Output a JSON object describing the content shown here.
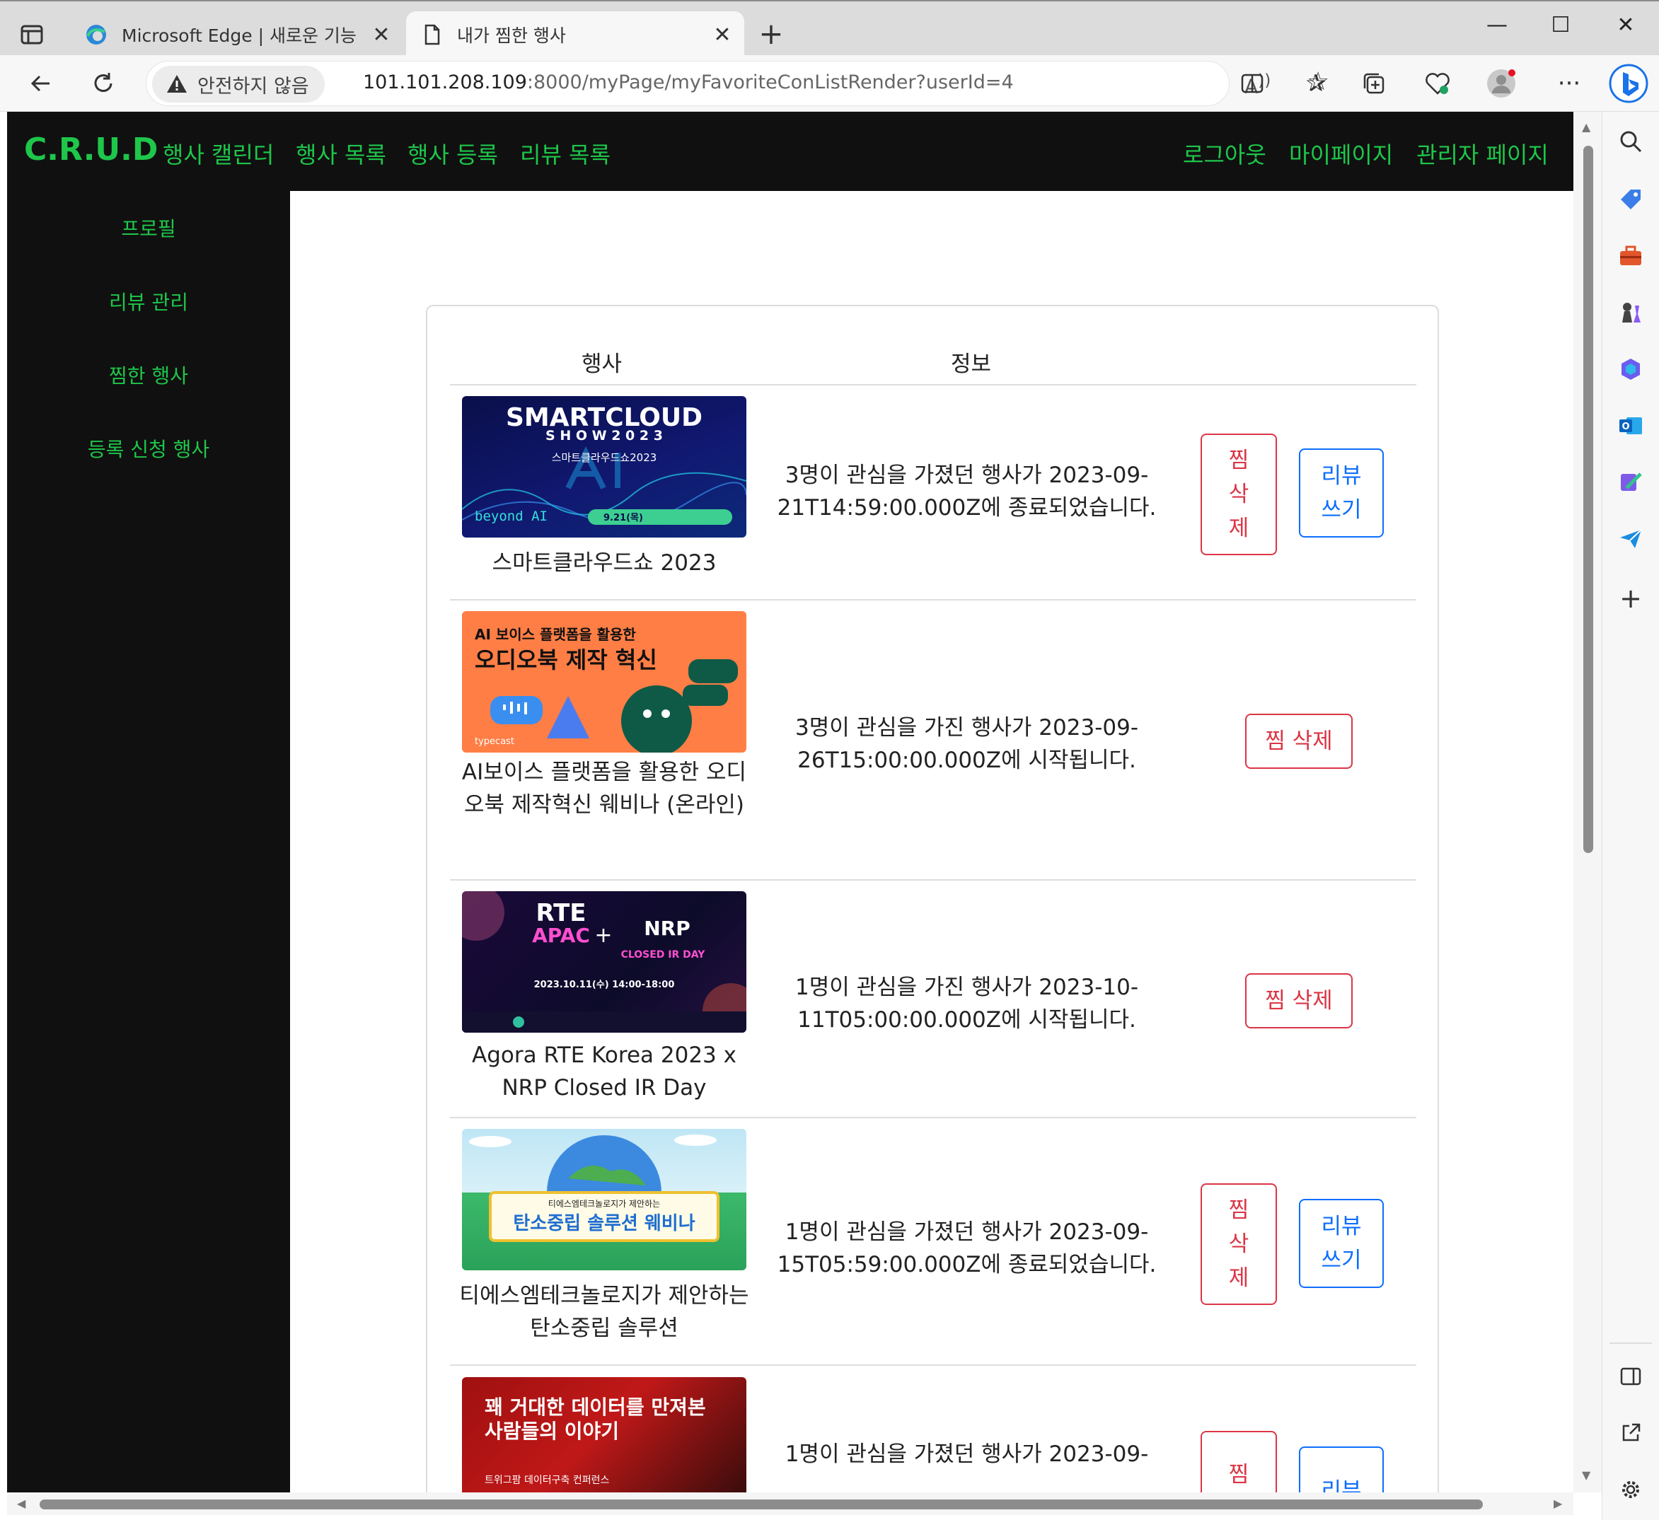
{
  "browser": {
    "tabs": [
      {
        "label": "Microsoft Edge | 새로운 기능"
      },
      {
        "label": "내가 찜한 행사"
      }
    ],
    "security_label": "안전하지 않음",
    "url_host": "101.101.208.109",
    "url_rest": ":8000/myPage/myFavoriteConListRender?userId=4"
  },
  "site": {
    "brand": "C.R.U.D",
    "nav_left": [
      "행사 캘린더",
      "행사 목록",
      "행사 등록",
      "리뷰 목록"
    ],
    "nav_right": [
      "로그아웃",
      "마이페이지",
      "관리자 페이지"
    ],
    "sidebar": [
      "프로필",
      "리뷰 관리",
      "찜한 행사",
      "등록 신청 행사"
    ]
  },
  "table": {
    "headers": [
      "행사",
      "정보"
    ],
    "rows": [
      {
        "title": "스마트클라우드쇼 2023",
        "info": "3명이 관심을 가졌던 행사가 2023-09-21T14:59:00.000Z에 종료되었습니다.",
        "delete_label": "찜 삭제",
        "review_label": "리뷰 쓰기",
        "poster": {
          "line1": "SMARTCLOUD",
          "line2": "S H O W 2 0 2 3",
          "line3": "스마트클라우드쇼2023",
          "line4": "beyond AI",
          "badge": "9.21(목)"
        }
      },
      {
        "title": "AI보이스 플랫폼을 활용한 오디오북 제작혁신 웨비나 (온라인)",
        "info": "3명이 관심을 가진 행사가 2023-09-26T15:00:00.000Z에 시작됩니다.",
        "delete_label": "찜 삭제",
        "poster": {
          "line1": "AI 보이스 플랫폼을 활용한",
          "line2": "오디오북 제작 혁신",
          "brand": "typecast"
        }
      },
      {
        "title": "Agora RTE Korea 2023 x NRP Closed IR Day",
        "info": "1명이 관심을 가진 행사가 2023-10-11T05:00:00.000Z에 시작됩니다.",
        "delete_label": "찜 삭제",
        "poster": {
          "line1": "RTE",
          "line2": "APAC",
          "line3": "NRP",
          "line4": "CLOSED IR DAY",
          "date": "2023.10.11(수) 14:00-18:00"
        }
      },
      {
        "title": "티에스엠테크놀로지가 제안하는 탄소중립 솔루션",
        "info": "1명이 관심을 가졌던 행사가 2023-09-15T05:59:00.000Z에 종료되었습니다.",
        "delete_label": "찜 삭제",
        "review_label": "리뷰 쓰기",
        "poster": {
          "line1": "티에스엠테크놀로지가 제안하는",
          "line2": "탄소중립 솔루션 웨비나"
        }
      },
      {
        "title": "",
        "info": "1명이 관심을 가졌던 행사가 2023-09-",
        "delete_label": "찜 삭",
        "review_label": "리뷰",
        "poster": {
          "line1": "꽤 거대한 데이터를 만져본",
          "line2": "사람들의 이야기",
          "line3": "트위그팜 데이터구축 컨퍼런스"
        }
      }
    ]
  }
}
